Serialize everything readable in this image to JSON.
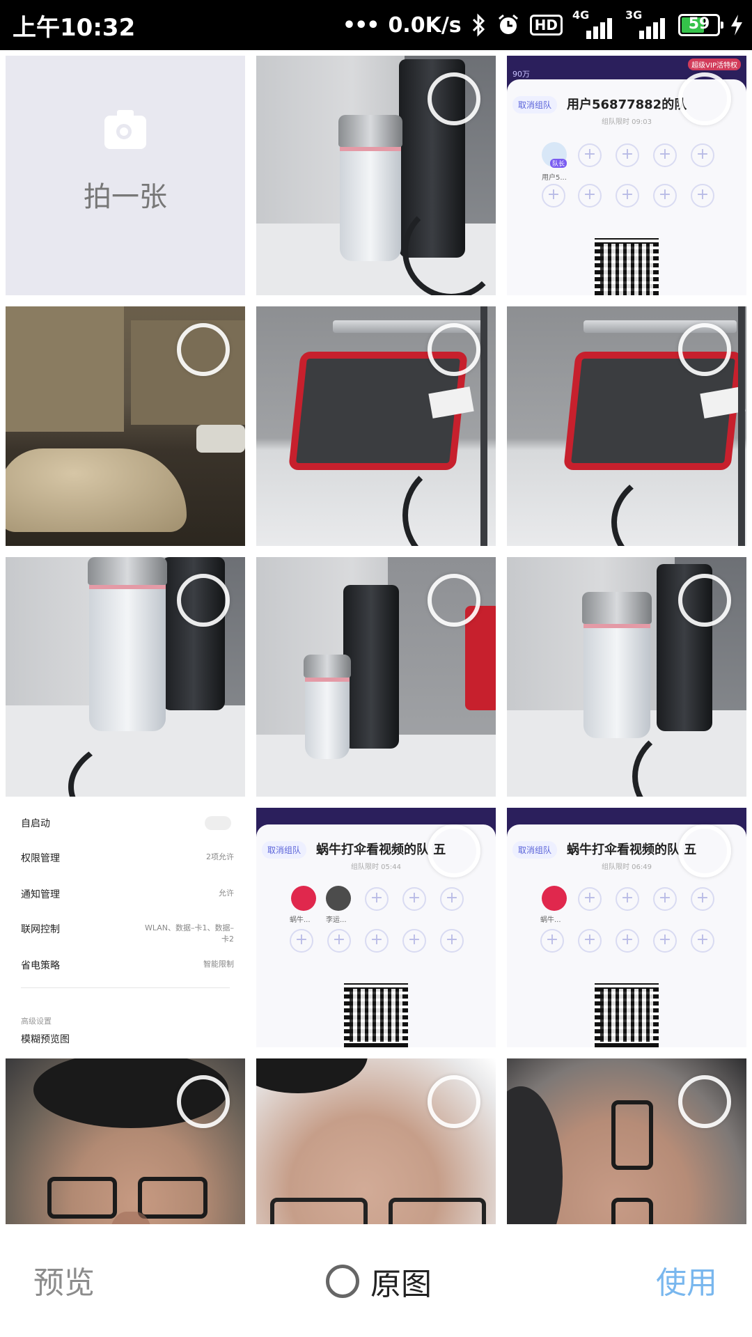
{
  "status_bar": {
    "time": "上午10:32",
    "net_speed": "0.0K/s",
    "hd_label": "HD",
    "sim1_type": "4G",
    "sim2_type": "3G",
    "battery": "59",
    "icons": [
      "more-dots-icon",
      "bluetooth-icon",
      "alarm-icon",
      "hd-icon",
      "signal-4g-icon",
      "signal-3g-icon",
      "battery-icon",
      "charging-icon"
    ]
  },
  "camera_tile": {
    "label": "拍一张",
    "icon": "camera-icon"
  },
  "app_screens": {
    "team1": {
      "cancel": "取消组队",
      "title": "用户56877882的队",
      "subtitle": "组队限时 09:03",
      "member": "用户5...",
      "badge": "队长",
      "corner": "90万",
      "tag": "超级VIP活特权"
    },
    "team2": {
      "cancel": "取消组队",
      "title": "蜗牛打伞看视频的队",
      "title_suffix": "五",
      "subtitle": "组队限时 05:44",
      "member1": "蜗牛...",
      "member2": "李运...",
      "badge": "队长"
    },
    "team3": {
      "cancel": "取消组队",
      "title": "蜗牛打伞看视频的队",
      "title_suffix": "五",
      "subtitle": "组队限时 06:49",
      "member1": "蜗牛...",
      "badge": "队长"
    }
  },
  "settings_screen": {
    "rows": [
      {
        "label": "自启动",
        "value": ""
      },
      {
        "label": "权限管理",
        "value": "2项允许"
      },
      {
        "label": "通知管理",
        "value": "允许"
      },
      {
        "label": "联网控制",
        "value": "WLAN、数据–卡1、数据–卡2"
      },
      {
        "label": "省电策略",
        "value": "智能限制"
      }
    ],
    "section": "高级设置",
    "last_row": "模糊预览图"
  },
  "bottom_bar": {
    "preview": "预览",
    "original": "原图",
    "use": "使用"
  },
  "colors": {
    "use_button": "#79b7ee",
    "preview_button": "#8c8c8c",
    "battery_fill": "#35c24a",
    "camera_tile_bg": "#e8e8f0"
  }
}
